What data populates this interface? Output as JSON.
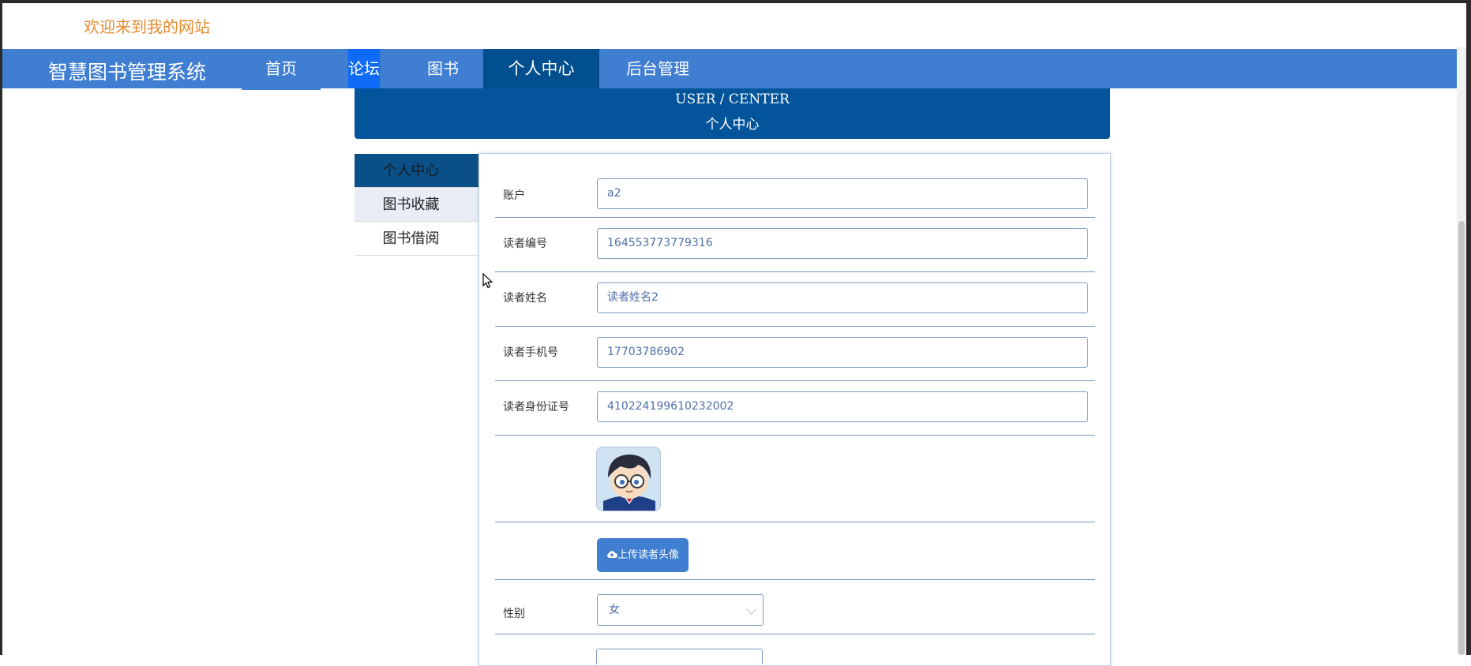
{
  "header": {
    "welcome_text": "欢迎来到我的网站"
  },
  "navbar": {
    "brand": "智慧图书管理系统",
    "items": [
      {
        "label": "首页"
      },
      {
        "label": "论坛"
      },
      {
        "label": "图书"
      },
      {
        "label": "个人中心",
        "active": true
      },
      {
        "label": "后台管理"
      }
    ]
  },
  "banner": {
    "title_en": "USER / CENTER",
    "title_cn": "个人中心"
  },
  "sidebar": {
    "items": [
      {
        "label": "个人中心",
        "active": true
      },
      {
        "label": "图书收藏"
      },
      {
        "label": "图书借阅"
      }
    ]
  },
  "form": {
    "fields": [
      {
        "label": "账户",
        "value": "a2"
      },
      {
        "label": "读者编号",
        "value": "164553773779316"
      },
      {
        "label": "读者姓名",
        "value": "读者姓名2"
      },
      {
        "label": "读者手机号",
        "value": "17703786902"
      },
      {
        "label": "读者身份证号",
        "value": "410224199610232002"
      }
    ],
    "upload_button": "上传读者头像",
    "gender": {
      "label": "性别",
      "selected": "女"
    }
  },
  "colors": {
    "nav_blue": "#3f7ed1",
    "active_blue": "#024f8f",
    "banner_blue": "#03549a",
    "welcome_orange": "#e58a2b"
  }
}
